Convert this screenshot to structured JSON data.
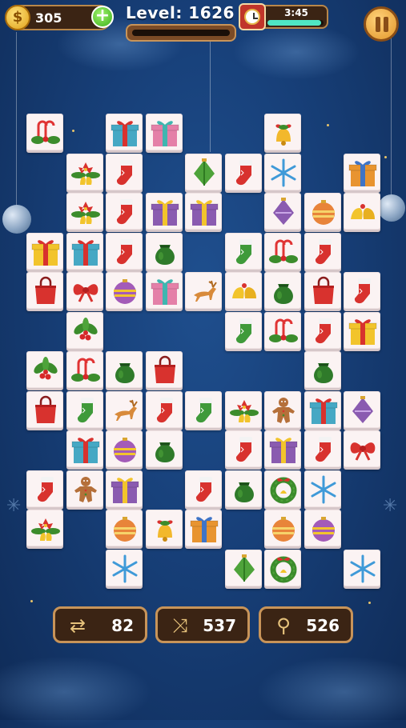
{
  "hud": {
    "coins": "305",
    "coin_symbol": "$",
    "add_symbol": "+",
    "level_text": "Level: 1626",
    "timer": "3:45",
    "timer_progress": 0.95
  },
  "tools": [
    {
      "name": "undo-tool",
      "icon": "swap-cards-icon",
      "glyph": "⇄",
      "value": "82"
    },
    {
      "name": "shuffle-tool",
      "icon": "shuffle-icon",
      "glyph": "⤨",
      "value": "537"
    },
    {
      "name": "hint-tool",
      "icon": "magnifier-icon",
      "glyph": "⚲",
      "value": "526"
    }
  ],
  "tile_types": [
    "candy-cane-holly",
    "gift-teal-red",
    "gift-pink-teal",
    "gift-yellow-red",
    "gift-purple-yellow",
    "gift-orange-blue",
    "stocking-red",
    "stocking-green",
    "snowflake",
    "bell-red-bow",
    "bells-gold",
    "ornament-green",
    "ornament-purple",
    "ornament-stripe-orange",
    "ornament-stripe-purple",
    "bow-red",
    "holly",
    "poinsettia-bells",
    "shopping-bag",
    "sack-green",
    "reindeer",
    "gingerbread",
    "wreath"
  ],
  "tiles": [
    {
      "col": 0,
      "row": 0,
      "type": "candy-cane-holly"
    },
    {
      "col": 2,
      "row": 0,
      "type": "gift-teal-red"
    },
    {
      "col": 3,
      "row": 0,
      "type": "gift-pink-teal"
    },
    {
      "col": 6,
      "row": 0,
      "type": "bell-red-bow"
    },
    {
      "col": 1,
      "row": 1,
      "type": "poinsettia-bells"
    },
    {
      "col": 2,
      "row": 1,
      "type": "stocking-red"
    },
    {
      "col": 4,
      "row": 1,
      "type": "ornament-green"
    },
    {
      "col": 5,
      "row": 1,
      "type": "stocking-red"
    },
    {
      "col": 6,
      "row": 1,
      "type": "snowflake"
    },
    {
      "col": 8,
      "row": 1,
      "type": "gift-orange-blue"
    },
    {
      "col": 1,
      "row": 2,
      "type": "poinsettia-bells"
    },
    {
      "col": 2,
      "row": 2,
      "type": "stocking-red"
    },
    {
      "col": 3,
      "row": 2,
      "type": "gift-purple-yellow"
    },
    {
      "col": 4,
      "row": 2,
      "type": "gift-purple-yellow"
    },
    {
      "col": 6,
      "row": 2,
      "type": "ornament-purple"
    },
    {
      "col": 7,
      "row": 2,
      "type": "ornament-stripe-orange"
    },
    {
      "col": 8,
      "row": 2,
      "type": "bells-gold"
    },
    {
      "col": 0,
      "row": 3,
      "type": "gift-yellow-red"
    },
    {
      "col": 1,
      "row": 3,
      "type": "gift-teal-red"
    },
    {
      "col": 2,
      "row": 3,
      "type": "stocking-red"
    },
    {
      "col": 3,
      "row": 3,
      "type": "sack-green"
    },
    {
      "col": 5,
      "row": 3,
      "type": "stocking-green"
    },
    {
      "col": 6,
      "row": 3,
      "type": "candy-cane-holly"
    },
    {
      "col": 7,
      "row": 3,
      "type": "stocking-red"
    },
    {
      "col": 0,
      "row": 4,
      "type": "shopping-bag"
    },
    {
      "col": 1,
      "row": 4,
      "type": "bow-red"
    },
    {
      "col": 2,
      "row": 4,
      "type": "ornament-stripe-purple"
    },
    {
      "col": 3,
      "row": 4,
      "type": "gift-pink-teal"
    },
    {
      "col": 4,
      "row": 4,
      "type": "reindeer"
    },
    {
      "col": 5,
      "row": 4,
      "type": "bells-gold"
    },
    {
      "col": 6,
      "row": 4,
      "type": "sack-green"
    },
    {
      "col": 7,
      "row": 4,
      "type": "shopping-bag"
    },
    {
      "col": 8,
      "row": 4,
      "type": "stocking-red"
    },
    {
      "col": 1,
      "row": 5,
      "type": "holly"
    },
    {
      "col": 5,
      "row": 5,
      "type": "stocking-green"
    },
    {
      "col": 6,
      "row": 5,
      "type": "candy-cane-holly"
    },
    {
      "col": 7,
      "row": 5,
      "type": "stocking-red"
    },
    {
      "col": 8,
      "row": 5,
      "type": "gift-yellow-red"
    },
    {
      "col": 0,
      "row": 6,
      "type": "holly"
    },
    {
      "col": 1,
      "row": 6,
      "type": "candy-cane-holly"
    },
    {
      "col": 2,
      "row": 6,
      "type": "sack-green"
    },
    {
      "col": 3,
      "row": 6,
      "type": "shopping-bag"
    },
    {
      "col": 7,
      "row": 6,
      "type": "sack-green"
    },
    {
      "col": 0,
      "row": 7,
      "type": "shopping-bag"
    },
    {
      "col": 1,
      "row": 7,
      "type": "stocking-green"
    },
    {
      "col": 2,
      "row": 7,
      "type": "reindeer"
    },
    {
      "col": 3,
      "row": 7,
      "type": "stocking-red"
    },
    {
      "col": 4,
      "row": 7,
      "type": "stocking-green"
    },
    {
      "col": 5,
      "row": 7,
      "type": "poinsettia-bells"
    },
    {
      "col": 6,
      "row": 7,
      "type": "gingerbread"
    },
    {
      "col": 7,
      "row": 7,
      "type": "gift-teal-red"
    },
    {
      "col": 8,
      "row": 7,
      "type": "ornament-purple"
    },
    {
      "col": 1,
      "row": 8,
      "type": "gift-teal-red"
    },
    {
      "col": 2,
      "row": 8,
      "type": "ornament-stripe-purple"
    },
    {
      "col": 3,
      "row": 8,
      "type": "sack-green"
    },
    {
      "col": 5,
      "row": 8,
      "type": "stocking-red"
    },
    {
      "col": 6,
      "row": 8,
      "type": "gift-purple-yellow"
    },
    {
      "col": 7,
      "row": 8,
      "type": "stocking-red"
    },
    {
      "col": 8,
      "row": 8,
      "type": "bow-red"
    },
    {
      "col": 0,
      "row": 9,
      "type": "stocking-red"
    },
    {
      "col": 1,
      "row": 9,
      "type": "gingerbread"
    },
    {
      "col": 2,
      "row": 9,
      "type": "gift-purple-yellow"
    },
    {
      "col": 4,
      "row": 9,
      "type": "stocking-red"
    },
    {
      "col": 5,
      "row": 9,
      "type": "sack-green"
    },
    {
      "col": 6,
      "row": 9,
      "type": "wreath"
    },
    {
      "col": 7,
      "row": 9,
      "type": "snowflake"
    },
    {
      "col": 0,
      "row": 10,
      "type": "poinsettia-bells"
    },
    {
      "col": 2,
      "row": 10,
      "type": "ornament-stripe-orange"
    },
    {
      "col": 3,
      "row": 10,
      "type": "bell-red-bow"
    },
    {
      "col": 4,
      "row": 10,
      "type": "gift-orange-blue"
    },
    {
      "col": 6,
      "row": 10,
      "type": "ornament-stripe-orange"
    },
    {
      "col": 7,
      "row": 10,
      "type": "ornament-stripe-purple"
    },
    {
      "col": 2,
      "row": 11,
      "type": "snowflake"
    },
    {
      "col": 5,
      "row": 11,
      "type": "ornament-green"
    },
    {
      "col": 6,
      "row": 11,
      "type": "wreath"
    },
    {
      "col": 8,
      "row": 11,
      "type": "snowflake"
    }
  ]
}
